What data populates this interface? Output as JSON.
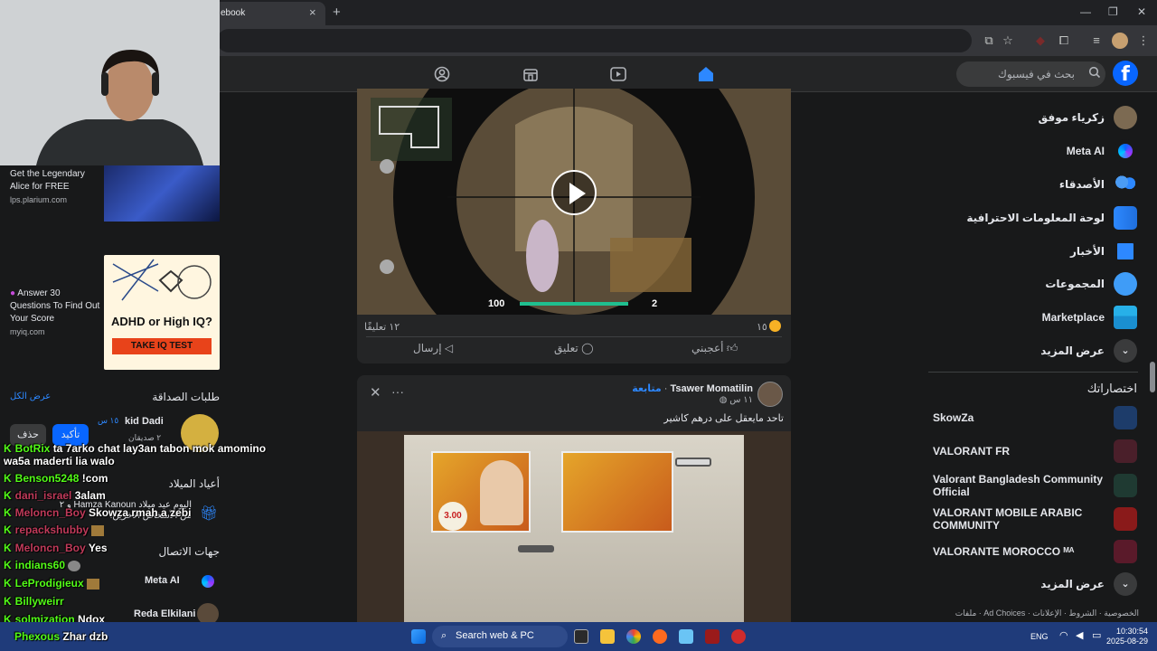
{
  "browser": {
    "tab_title": "ebook",
    "tab_close": "×",
    "new_tab": "+",
    "minimize": "—",
    "restore": "❐",
    "close": "✕"
  },
  "fb_nav": {
    "search_placeholder": "بحث في فيسبوك",
    "logo": "f"
  },
  "post1": {
    "hud_health": "100",
    "hud_ammo": "2",
    "reaction_count": "١٥",
    "comments_count": "١٢ تعليقًا",
    "like_label": "أعجبني",
    "comment_label": "تعليق",
    "send_label": "إرسال"
  },
  "post2": {
    "author": "Tsawer Momatilin",
    "follow": "متابعة",
    "time": "١١ س",
    "caption": "تاحد مايعقل على درهم كاشير",
    "more": "···",
    "close": "✕",
    "poster_price": "3.00"
  },
  "sidebar": {
    "profile_name": "زكرياء موفق",
    "items": [
      {
        "label": "Meta AI"
      },
      {
        "label": "الأصدقاء"
      },
      {
        "label": "لوحة المعلومات الاحترافية"
      },
      {
        "label": "الأخبار"
      },
      {
        "label": "المجموعات"
      },
      {
        "label": "Marketplace"
      },
      {
        "label": "عرض المزيد"
      }
    ],
    "shortcuts_title": "اختصاراتك",
    "shortcuts": [
      {
        "label": "SkowZa"
      },
      {
        "label": "VALORANT FR"
      },
      {
        "label": "Valorant Bangladesh Community Official"
      },
      {
        "label": "VALORANT MOBILE ARABIC COMMUNITY"
      },
      {
        "label": "VALORANTE MOROCCO ᴹᴬ"
      },
      {
        "label": "عرض المزيد"
      }
    ],
    "footer": "الخصوصية · الشروط · الإعلانات · Ad Choices · ملفات"
  },
  "right_rail": {
    "ad1_text": "Get the Legendary Alice for FREE",
    "ad1_src": "lps.plarium.com",
    "ad2_text": "Answer 30 Questions To Find Out Your Score",
    "ad2_src": "myiq.com",
    "ad2_title": "ADHD or High IQ?",
    "ad2_cta": "TAKE IQ TEST",
    "friend_requests_title": "طلبات الصداقة",
    "see_all": "عرض الكل",
    "request_name": "kid Dadi",
    "request_time": "١٥ س",
    "request_mutual": "٢ صديقان",
    "confirm": "تأكيد",
    "delete": "حذف",
    "birthdays_title": "أعياد الميلاد",
    "birthday_text": "اليوم عيد ميلاد Hamza Kanoun و ٢ من الأشخاص الآخرين.",
    "contacts_title": "جهات الاتصال",
    "contacts": [
      "Meta AI",
      "Reda Elkilani"
    ]
  },
  "chat": [
    {
      "user": "BotRix",
      "msg": "ta 7arko chat lay3an tabon mok amomino",
      "color": "#53fc18"
    },
    {
      "user": "",
      "msg": "wa5a maderti lia walo",
      "color": "#ffffff"
    },
    {
      "user": "Benson5248",
      "msg": "!com",
      "color": "#53fc18"
    },
    {
      "user": "dani_israel",
      "msg": "3alam",
      "color": "#c03a5a"
    },
    {
      "user": "Meloncn_Boy",
      "msg": "Skowza rmah a zebi",
      "color": "#c03a5a"
    },
    {
      "user": "repackshubby",
      "msg": "",
      "color": "#c03a5a"
    },
    {
      "user": "Meloncn_Boy",
      "msg": "Yes",
      "color": "#c03a5a"
    },
    {
      "user": "indians60",
      "msg": "",
      "color": "#53fc18"
    },
    {
      "user": "LeProdigieux",
      "msg": "",
      "color": "#53fc18"
    },
    {
      "user": "Billyweirr",
      "msg": "",
      "color": "#53fc18"
    },
    {
      "user": "solmization",
      "msg": "Ndox",
      "color": "#53fc18"
    },
    {
      "user": "Phexous",
      "msg": "Zhar dzb",
      "color": "#53fc18"
    }
  ],
  "taskbar": {
    "search": "Search web & PC",
    "lang": "ENG",
    "time": "10:30:54",
    "date": "2025-08-29"
  },
  "colors": {
    "accent": "#2d88ff",
    "kick_green": "#53fc18",
    "fb_blue": "#0866ff"
  }
}
